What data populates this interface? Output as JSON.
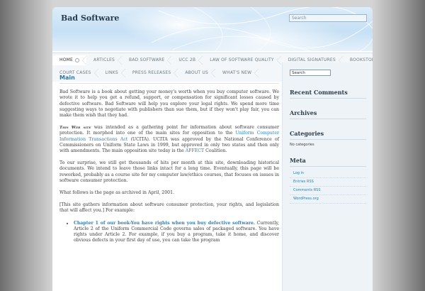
{
  "header": {
    "site_title": "Bad Software",
    "search_placeholder": "Search"
  },
  "nav": {
    "row1": [
      {
        "label": "Home",
        "active": true
      },
      {
        "label": "Articles"
      },
      {
        "label": "Bad Software"
      },
      {
        "label": "UCC 2B"
      },
      {
        "label": "Law of Software Quality"
      },
      {
        "label": "Digital Signatures"
      },
      {
        "label": "Bookstore"
      }
    ],
    "row2": [
      {
        "label": "Court Cases"
      },
      {
        "label": "Links"
      },
      {
        "label": "Press Releases"
      },
      {
        "label": "About Us"
      },
      {
        "label": "What's New"
      }
    ]
  },
  "main": {
    "title": "Main",
    "p1": "Bad Software is a book about getting your money's worth when you buy computer software. We wrote it to help you get a refund, support, or compensation for significant losses caused by defective software. Bad Software will help you explore your legal rights. We spend more time suggesting ways to negotiate with publishers than sue them, but if they won't play fair, you can make them wish that they had.",
    "p2_smallcaps": "This Web site",
    "p2_a": " was intended as a gathering point for information about software consumer protection. It morphed into one of the main sites for opposition to the ",
    "p2_link1": "Uniform Computer Information Transactions Act",
    "p2_b": " (UCITA). UCITA was approved by the National Conference of Commissioners on Uniform State Laws in 1999, but approved in only two states and then only with amendments. The main opposition site today is the ",
    "p2_link2": "AFFECT",
    "p2_c": " Coalition.",
    "p3": "To our surprise, we still get thousands of hits per month at this site, downloading historical documents. We intend to leave those links intact for a long time. Eventually, this page will be reworked, probably as a course site for my computer law/ethics courses, that focuses on issues in software consumer protection.",
    "p4": "What follows is the page as archived in April, 2001.",
    "p5": "[This site gathers information about software consumer protection, your rights, and legislation that will affect you.] For example:",
    "li1_link": "Chapter 1 of our book-You have rights when you buy defective software.",
    "li1_text": " Currently, Article 2 of the Uniform Commercial Code governs sales of packaged software. You have rights under Article 2. For example, if you buy a program, take it home, and discover obvious defects in your first day of use, you can take the program"
  },
  "sidebar": {
    "search_value": "Search",
    "recent_comments": "Recent Comments",
    "archives": "Archives",
    "categories": "Categories",
    "no_categories": "No categories",
    "meta": "Meta",
    "meta_links": [
      "Log in",
      "Entries RSS",
      "Comments RSS",
      "WordPress.org"
    ]
  }
}
